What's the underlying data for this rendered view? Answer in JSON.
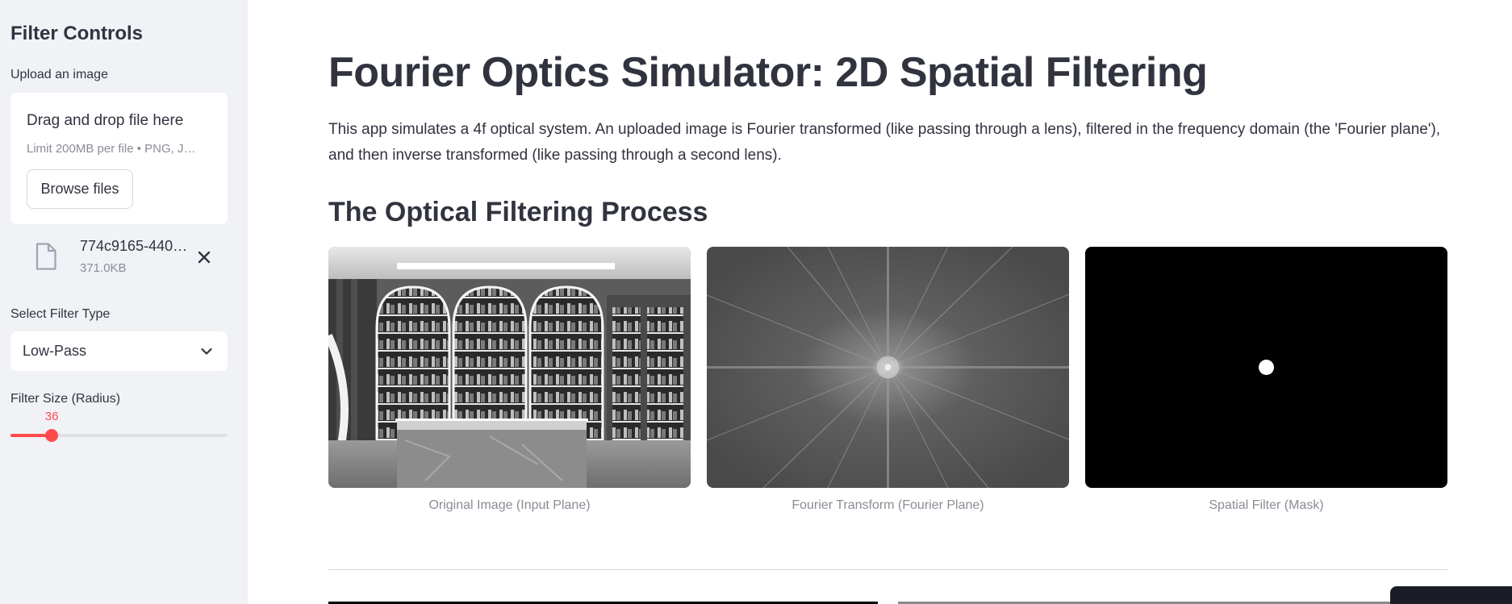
{
  "sidebar": {
    "title": "Filter Controls",
    "upload_label": "Upload an image",
    "dropzone_title": "Drag and drop file here",
    "dropzone_limit": "Limit 200MB per file • PNG, J…",
    "browse_label": "Browse files",
    "file_name": "774c9165-440…",
    "file_size": "371.0KB",
    "filter_type_label": "Select Filter Type",
    "filter_type_value": "Low-Pass",
    "radius_label": "Filter Size (Radius)",
    "radius_value": "36",
    "radius_fraction": 0.19,
    "accent_color": "#ff4b4b"
  },
  "main": {
    "title": "Fourier Optics Simulator: 2D Spatial Filtering",
    "intro": "This app simulates a 4f optical system. An uploaded image is Fourier transformed (like passing through a lens), filtered in the frequency domain (the 'Fourier plane'), and then inverse transformed (like passing through a second lens).",
    "section_title": "The Optical Filtering Process",
    "panels": [
      {
        "caption": "Original Image (Input Plane)",
        "icon": "grayscale-store-interior-image"
      },
      {
        "caption": "Fourier Transform (Fourier Plane)",
        "icon": "fourier-spectrum-image"
      },
      {
        "caption": "Spatial Filter (Mask)",
        "icon": "circular-mask-image"
      }
    ]
  }
}
